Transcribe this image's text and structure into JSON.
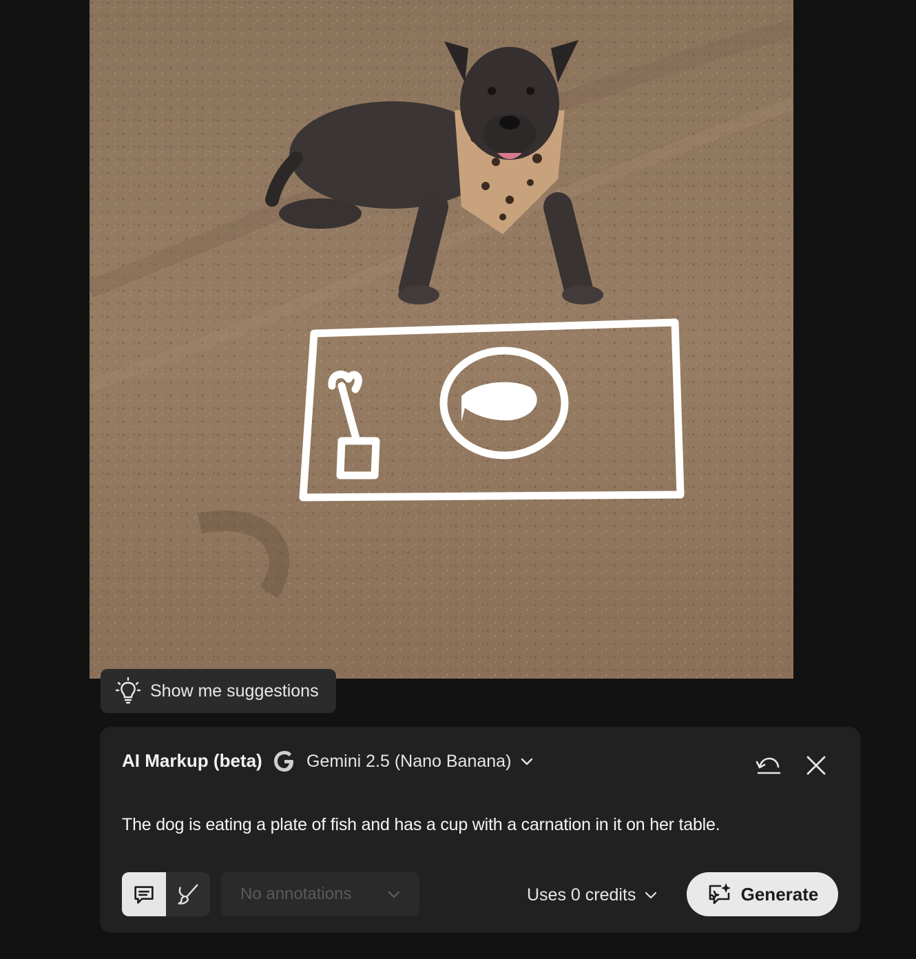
{
  "canvas": {
    "image": "photo of a brindle dog lying on dirt wearing a leopard-print bandana, with white hand-drawn annotation of a table, cup with carnation, and plate with fish",
    "markup_color": "#ffffff"
  },
  "suggestions": {
    "label": "Show me suggestions",
    "icon": "lightbulb-icon"
  },
  "panel": {
    "title": "AI Markup (beta)",
    "model": {
      "icon": "google-g-icon",
      "name": "Gemini 2.5 (Nano Banana)",
      "chevron": "chevron-down-icon"
    },
    "undo_icon": "undo-icon",
    "close_icon": "close-icon",
    "prompt_text": "The dog is eating a plate of fish and has a cup with a carnation in it on her table.",
    "modes": [
      {
        "icon": "comment-icon",
        "active": true
      },
      {
        "icon": "brush-icon",
        "active": false
      }
    ],
    "annotations": {
      "value": "No annotations",
      "disabled": true
    },
    "credits": {
      "label": "Uses 0 credits"
    },
    "generate": {
      "label": "Generate",
      "icon": "sparkle-comment-icon"
    }
  },
  "colors": {
    "background": "#121212",
    "panel": "#212121",
    "button_light": "#e9e9e9"
  }
}
